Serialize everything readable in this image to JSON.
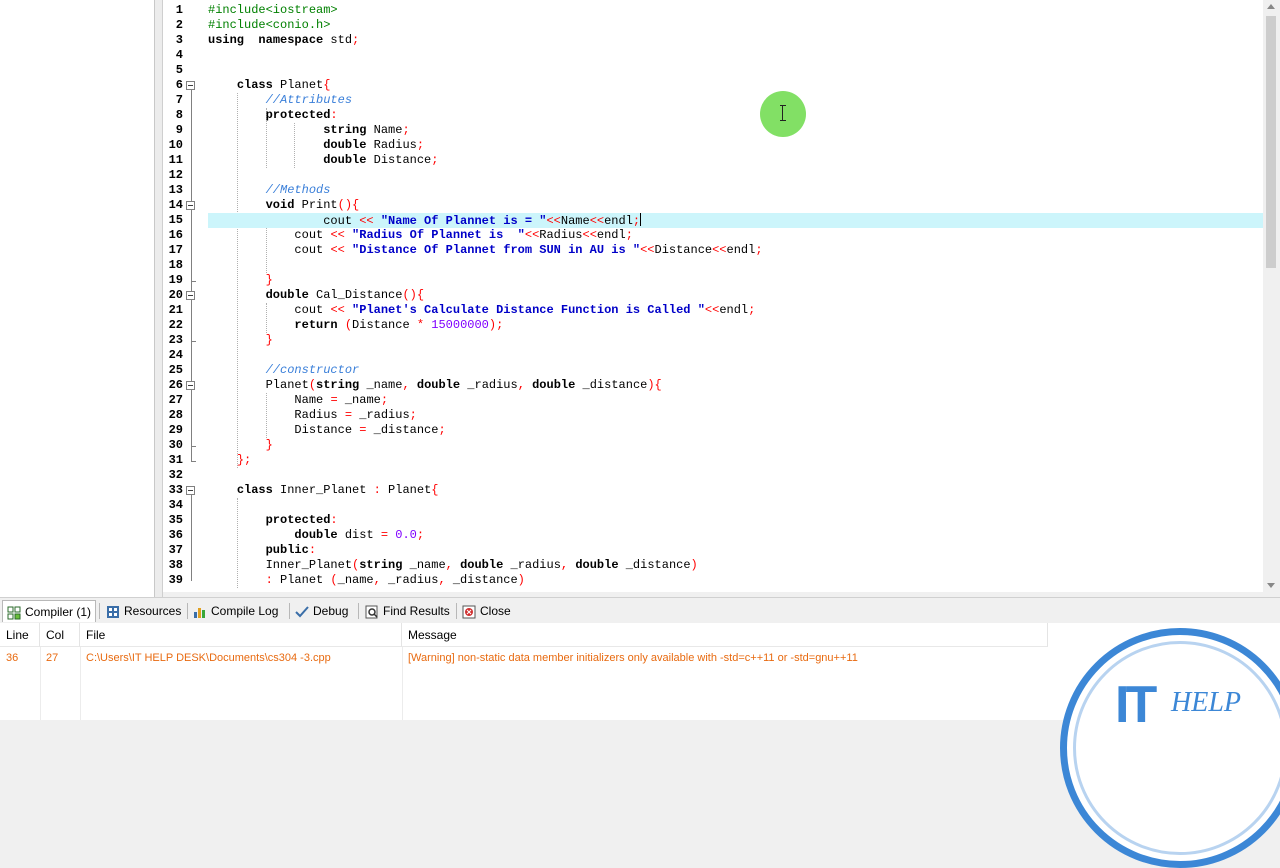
{
  "editor": {
    "lines": [
      [
        [
          "pp",
          "#include<iostream>"
        ]
      ],
      [
        [
          "pp",
          "#include<conio.h>"
        ]
      ],
      [
        [
          "kw",
          "using"
        ],
        [
          "",
          "  "
        ],
        [
          "kw",
          "namespace"
        ],
        [
          "",
          " std"
        ],
        [
          "sy",
          ";"
        ]
      ],
      [],
      [],
      [
        [
          "",
          "    "
        ],
        [
          "kw",
          "class"
        ],
        [
          "",
          " Planet"
        ],
        [
          "sy",
          "{"
        ]
      ],
      [
        [
          "",
          "        "
        ],
        [
          "cm",
          "//Attributes"
        ]
      ],
      [
        [
          "",
          "        "
        ],
        [
          "kw",
          "protected"
        ],
        [
          "sy",
          ":"
        ]
      ],
      [
        [
          "",
          "                "
        ],
        [
          "kw",
          "string"
        ],
        [
          "",
          " Name"
        ],
        [
          "sy",
          ";"
        ]
      ],
      [
        [
          "",
          "                "
        ],
        [
          "kw",
          "double"
        ],
        [
          "",
          " Radius"
        ],
        [
          "sy",
          ";"
        ]
      ],
      [
        [
          "",
          "                "
        ],
        [
          "kw",
          "double"
        ],
        [
          "",
          " Distance"
        ],
        [
          "sy",
          ";"
        ]
      ],
      [],
      [
        [
          "",
          "        "
        ],
        [
          "cm",
          "//Methods"
        ]
      ],
      [
        [
          "",
          "        "
        ],
        [
          "kw",
          "void"
        ],
        [
          "",
          " Print"
        ],
        [
          "sy",
          "(){"
        ]
      ],
      [
        [
          "",
          "                "
        ],
        [
          "",
          "cout "
        ],
        [
          "sy",
          "<<"
        ],
        [
          "",
          " "
        ],
        [
          "st",
          "\"Name Of Plannet is = \""
        ],
        [
          "sy",
          "<<"
        ],
        [
          "",
          "Name"
        ],
        [
          "sy",
          "<<"
        ],
        [
          "",
          "endl"
        ],
        [
          "sy",
          ";"
        ],
        [
          "caret",
          ""
        ]
      ],
      [
        [
          "",
          "            "
        ],
        [
          "",
          "cout "
        ],
        [
          "sy",
          "<<"
        ],
        [
          "",
          " "
        ],
        [
          "st",
          "\"Radius Of Plannet is  \""
        ],
        [
          "sy",
          "<<"
        ],
        [
          "",
          "Radius"
        ],
        [
          "sy",
          "<<"
        ],
        [
          "",
          "endl"
        ],
        [
          "sy",
          ";"
        ]
      ],
      [
        [
          "",
          "            "
        ],
        [
          "",
          "cout "
        ],
        [
          "sy",
          "<<"
        ],
        [
          "",
          " "
        ],
        [
          "st",
          "\"Distance Of Plannet from SUN in AU is \""
        ],
        [
          "sy",
          "<<"
        ],
        [
          "",
          "Distance"
        ],
        [
          "sy",
          "<<"
        ],
        [
          "",
          "endl"
        ],
        [
          "sy",
          ";"
        ]
      ],
      [],
      [
        [
          "",
          "        "
        ],
        [
          "sy",
          "}"
        ]
      ],
      [
        [
          "",
          "        "
        ],
        [
          "kw",
          "double"
        ],
        [
          "",
          " Cal_Distance"
        ],
        [
          "sy",
          "(){"
        ]
      ],
      [
        [
          "",
          "            "
        ],
        [
          "",
          "cout "
        ],
        [
          "sy",
          "<<"
        ],
        [
          "",
          " "
        ],
        [
          "st",
          "\"Planet's Calculate Distance Function is Called \""
        ],
        [
          "sy",
          "<<"
        ],
        [
          "",
          "endl"
        ],
        [
          "sy",
          ";"
        ]
      ],
      [
        [
          "",
          "            "
        ],
        [
          "kw",
          "return"
        ],
        [
          "",
          " "
        ],
        [
          "sy",
          "("
        ],
        [
          "",
          "Distance "
        ],
        [
          "sy",
          "*"
        ],
        [
          "",
          " "
        ],
        [
          "nm",
          "15000000"
        ],
        [
          "sy",
          ");"
        ]
      ],
      [
        [
          "",
          "        "
        ],
        [
          "sy",
          "}"
        ]
      ],
      [],
      [
        [
          "",
          "        "
        ],
        [
          "cm",
          "//constructor"
        ]
      ],
      [
        [
          "",
          "        "
        ],
        [
          "",
          "Planet"
        ],
        [
          "sy",
          "("
        ],
        [
          "kw",
          "string"
        ],
        [
          "",
          " _name"
        ],
        [
          "sy",
          ","
        ],
        [
          "",
          " "
        ],
        [
          "kw",
          "double"
        ],
        [
          "",
          " _radius"
        ],
        [
          "sy",
          ","
        ],
        [
          "",
          " "
        ],
        [
          "kw",
          "double"
        ],
        [
          "",
          " _distance"
        ],
        [
          "sy",
          "){"
        ]
      ],
      [
        [
          "",
          "            "
        ],
        [
          "",
          "Name "
        ],
        [
          "sy",
          "="
        ],
        [
          "",
          " _name"
        ],
        [
          "sy",
          ";"
        ]
      ],
      [
        [
          "",
          "            "
        ],
        [
          "",
          "Radius "
        ],
        [
          "sy",
          "="
        ],
        [
          "",
          " _radius"
        ],
        [
          "sy",
          ";"
        ]
      ],
      [
        [
          "",
          "            "
        ],
        [
          "",
          "Distance "
        ],
        [
          "sy",
          "="
        ],
        [
          "",
          " _distance"
        ],
        [
          "sy",
          ";"
        ]
      ],
      [
        [
          "",
          "        "
        ],
        [
          "sy",
          "}"
        ]
      ],
      [
        [
          "",
          "    "
        ],
        [
          "sy",
          "};"
        ]
      ],
      [],
      [
        [
          "",
          "    "
        ],
        [
          "kw",
          "class"
        ],
        [
          "",
          " Inner_Planet "
        ],
        [
          "sy",
          ":"
        ],
        [
          "",
          " Planet"
        ],
        [
          "sy",
          "{"
        ]
      ],
      [],
      [
        [
          "",
          "        "
        ],
        [
          "kw",
          "protected"
        ],
        [
          "sy",
          ":"
        ]
      ],
      [
        [
          "",
          "            "
        ],
        [
          "kw",
          "double"
        ],
        [
          "",
          " dist "
        ],
        [
          "sy",
          "="
        ],
        [
          "",
          " "
        ],
        [
          "nm",
          "0.0"
        ],
        [
          "sy",
          ";"
        ]
      ],
      [
        [
          "",
          "        "
        ],
        [
          "kw",
          "public"
        ],
        [
          "sy",
          ":"
        ]
      ],
      [
        [
          "",
          "        "
        ],
        [
          "",
          "Inner_Planet"
        ],
        [
          "sy",
          "("
        ],
        [
          "kw",
          "string"
        ],
        [
          "",
          " _name"
        ],
        [
          "sy",
          ","
        ],
        [
          "",
          " "
        ],
        [
          "kw",
          "double"
        ],
        [
          "",
          " _radius"
        ],
        [
          "sy",
          ","
        ],
        [
          "",
          " "
        ],
        [
          "kw",
          "double"
        ],
        [
          "",
          " _distance"
        ],
        [
          "sy",
          ")"
        ]
      ],
      [
        [
          "",
          "        "
        ],
        [
          "sy",
          ":"
        ],
        [
          "",
          " Planet "
        ],
        [
          "sy",
          "("
        ],
        [
          "",
          "_name"
        ],
        [
          "sy",
          ","
        ],
        [
          "",
          " _radius"
        ],
        [
          "sy",
          ","
        ],
        [
          "",
          " _distance"
        ],
        [
          "sy",
          ")"
        ]
      ]
    ],
    "line_numbers": [
      "1",
      "2",
      "3",
      "4",
      "5",
      "6",
      "7",
      "8",
      "9",
      "10",
      "11",
      "12",
      "13",
      "14",
      "15",
      "16",
      "17",
      "18",
      "19",
      "20",
      "21",
      "22",
      "23",
      "24",
      "25",
      "26",
      "27",
      "28",
      "29",
      "30",
      "31",
      "32",
      "33",
      "34",
      "35",
      "36",
      "37",
      "38",
      "39"
    ],
    "current_line": 15
  },
  "tabs": [
    {
      "label": "Compiler (1)",
      "icon": "compiler-icon",
      "active": true
    },
    {
      "label": "Resources",
      "icon": "resources-icon"
    },
    {
      "label": "Compile Log",
      "icon": "compile-log-icon"
    },
    {
      "label": "Debug",
      "icon": "debug-icon"
    },
    {
      "label": "Find Results",
      "icon": "find-results-icon"
    },
    {
      "label": "Close",
      "icon": "close-icon"
    }
  ],
  "messages": {
    "headers": {
      "line": "Line",
      "col": "Col",
      "file": "File",
      "message": "Message"
    },
    "rows": [
      {
        "line": "36",
        "col": "27",
        "file": "C:\\Users\\IT HELP DESK\\Documents\\cs304 -3.cpp",
        "message": "[Warning] non-static data member initializers only available with -std=c++11 or -std=gnu++11"
      }
    ]
  },
  "logo": {
    "it": "IT",
    "help": "HELP"
  },
  "colors": {
    "message_text": "#e86a10",
    "current_line": "#ccf5fb",
    "logo_blue": "#3c87d6"
  }
}
